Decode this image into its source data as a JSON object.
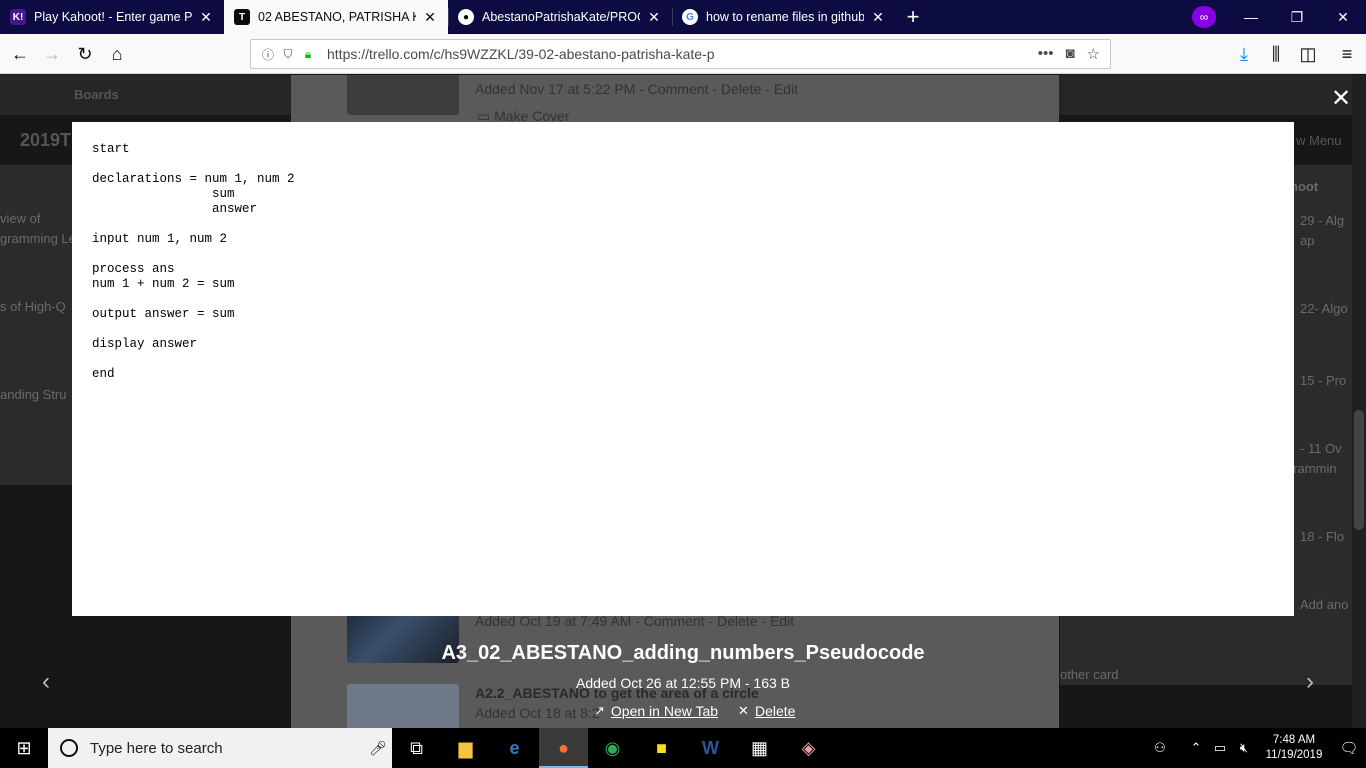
{
  "browser": {
    "tabs": [
      {
        "title": "Play Kahoot! - Enter game PIN",
        "favicon": "K!",
        "color": "#46178f",
        "active": false
      },
      {
        "title": "02 ABESTANO, PATRISHA KATE",
        "favicon": "T",
        "color": "#0c0c0d",
        "active": true
      },
      {
        "title": "AbestanoPatrishaKate/PROGC",
        "favicon": "gh",
        "color": "#ffffff",
        "active": false
      },
      {
        "title": "how to rename files in github -",
        "favicon": "G",
        "color": "#ffffff",
        "active": false
      }
    ],
    "url": "https://trello.com/c/hs9WZZKL/39-02-abestano-patrisha-kate-p"
  },
  "background": {
    "nav_boards": "Boards",
    "board_title": "2019T",
    "menu_label": "w Menu",
    "list_header": "hoot",
    "left_fragments": [
      "view of",
      "gramming Le",
      "s of High-Q",
      "anding Stru"
    ],
    "right_fragments": [
      "29 - Alg",
      "ap",
      "22- Algo",
      "15 - Pro",
      "- 11 Ov",
      "grammin",
      "18 - Flo",
      "Add ano",
      "other card"
    ],
    "attachments": [
      {
        "meta": "Added Nov 17 at 5:22 PM",
        "comment": "Comment",
        "delete": "Delete",
        "edit": "Edit",
        "cover": "Make Cover"
      },
      {
        "meta": "Added Oct 19 at 7:49 AM",
        "comment": "Comment",
        "delete": "Delete",
        "edit": "Edit"
      },
      {
        "name": "A2.2_ABESTANO to get the area of a circle",
        "meta": "Added Oct 18 at 8:2"
      }
    ]
  },
  "preview": {
    "content": "start\n\ndeclarations = num 1, num 2\n                sum\n                answer\n\ninput num 1, num 2\n\nprocess ans\nnum 1 + num 2 = sum\n\noutput answer = sum\n\ndisplay answer\n\nend",
    "filename": "A3_02_ABESTANO_adding_numbers_Pseudocode",
    "meta": "Added Oct 26 at 12:55 PM - 163 B",
    "open_new_tab": "Open in New Tab",
    "delete": "Delete"
  },
  "taskbar": {
    "search_placeholder": "Type here to search",
    "time": "7:48 AM",
    "date": "11/19/2019"
  }
}
